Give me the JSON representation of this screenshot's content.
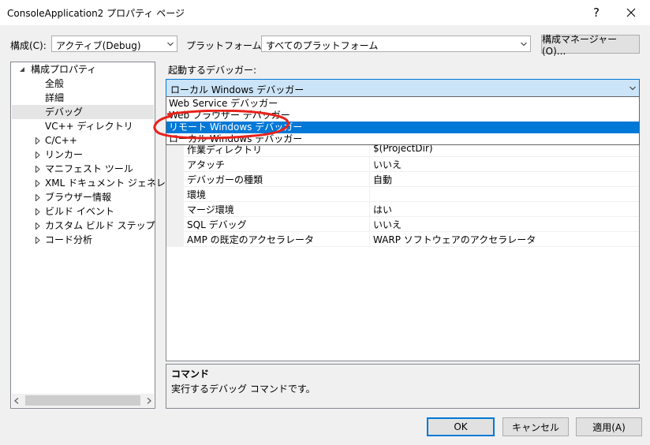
{
  "window": {
    "title": "ConsoleApplication2 プロパティ ページ",
    "help_label": "?",
    "close_icon": "close-icon"
  },
  "toolbar": {
    "config_label": "構成(C):",
    "config_value": "アクティブ(Debug)",
    "platform_label": "プラットフォーム(P):",
    "platform_value": "すべてのプラットフォーム",
    "config_manager_label": "構成マネージャー(O)..."
  },
  "tree": {
    "root": "構成プロパティ",
    "items": [
      {
        "label": "全般",
        "expandable": false,
        "selected": false
      },
      {
        "label": "詳細",
        "expandable": false,
        "selected": false
      },
      {
        "label": "デバッグ",
        "expandable": false,
        "selected": true
      },
      {
        "label": "VC++ ディレクトリ",
        "expandable": false,
        "selected": false
      },
      {
        "label": "C/C++",
        "expandable": true,
        "selected": false
      },
      {
        "label": "リンカー",
        "expandable": true,
        "selected": false
      },
      {
        "label": "マニフェスト ツール",
        "expandable": true,
        "selected": false
      },
      {
        "label": "XML ドキュメント ジェネレーター",
        "expandable": true,
        "selected": false
      },
      {
        "label": "ブラウザー情報",
        "expandable": true,
        "selected": false
      },
      {
        "label": "ビルド イベント",
        "expandable": true,
        "selected": false
      },
      {
        "label": "カスタム ビルド ステップ",
        "expandable": true,
        "selected": false
      },
      {
        "label": "コード分析",
        "expandable": true,
        "selected": false
      }
    ]
  },
  "debugger": {
    "label": "起動するデバッガー:",
    "value": "ローカル Windows デバッガー",
    "options": [
      {
        "label": "Web Service デバッガー",
        "selected": false
      },
      {
        "label": "Web ブラウザー デバッガー",
        "selected": false
      },
      {
        "label": "リモート Windows デバッガー",
        "selected": true
      },
      {
        "label": "ローカル Windows デバッガー",
        "selected": false
      }
    ]
  },
  "properties": [
    {
      "name": "作業ディレクトリ",
      "value": "$(ProjectDir)"
    },
    {
      "name": "アタッチ",
      "value": "いいえ"
    },
    {
      "name": "デバッガーの種類",
      "value": "自動"
    },
    {
      "name": "環境",
      "value": ""
    },
    {
      "name": "マージ環境",
      "value": "はい"
    },
    {
      "name": "SQL デバッグ",
      "value": "いいえ"
    },
    {
      "name": "AMP の既定のアクセラレータ",
      "value": "WARP ソフトウェアのアクセラレータ"
    }
  ],
  "description": {
    "title": "コマンド",
    "text": "実行するデバッグ コマンドです。"
  },
  "buttons": {
    "ok": "OK",
    "cancel": "キャンセル",
    "apply": "適用(A)"
  },
  "colors": {
    "selection": "#0078d7",
    "annotation": "#e8211a"
  }
}
